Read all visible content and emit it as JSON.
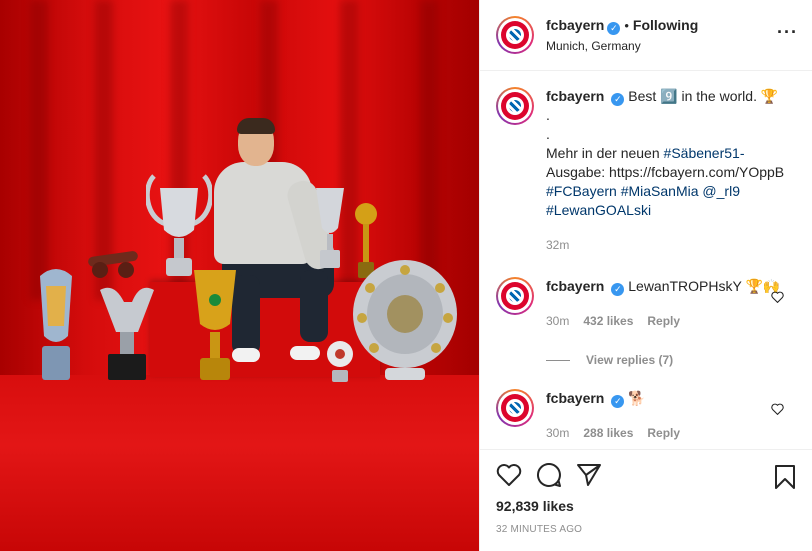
{
  "header": {
    "username": "fcbayern",
    "verified": true,
    "separator": "•",
    "follow_state": "Following",
    "location": "Munich, Germany",
    "more_icon": "more-dots-icon"
  },
  "caption": {
    "username": "fcbayern",
    "line1": "Best 9️⃣ in the world. 🏆",
    "line2": ".",
    "line3": ".",
    "line4_prefix": "Mehr in der neuen ",
    "line4_tag": "#Säbener51-",
    "line5": "Ausgabe: https://fcbayern.com/YOppB",
    "tags_line1a": "#FCBayern",
    "tags_line1b": "#MiaSanMia",
    "tags_line1c": "@_rl9",
    "tags_line2": "#LewanGOALski",
    "time": "32m"
  },
  "comments": [
    {
      "username": "fcbayern",
      "text": "LewanTROPHskY 🏆🙌",
      "time": "30m",
      "likes": "432 likes",
      "reply": "Reply",
      "view_replies": "View replies (7)"
    },
    {
      "username": "fcbayern",
      "text": "🐕",
      "time": "30m",
      "likes": "288 likes",
      "reply": "Reply"
    }
  ],
  "actions": {
    "icons": [
      "heart-icon",
      "comment-icon",
      "share-icon",
      "bookmark-icon"
    ],
    "likes": "92,839 likes",
    "timestamp": "32 MINUTES AGO"
  },
  "colors": {
    "link": "#00376b",
    "verified": "#3897f0",
    "muted": "#8e8e8e",
    "curtain_red": "#d40c0c"
  }
}
